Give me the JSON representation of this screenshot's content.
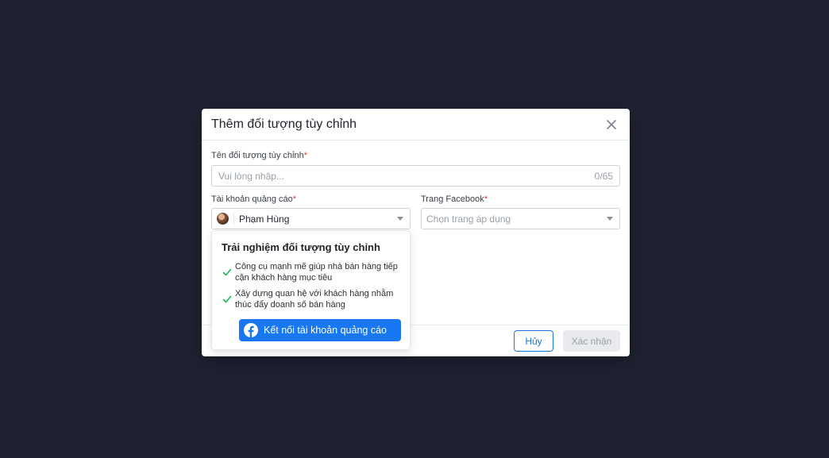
{
  "dialog": {
    "title": "Thêm đối tượng tùy chỉnh",
    "name_field": {
      "label": "Tên đối tượng tùy chỉnh",
      "required_mark": "*",
      "placeholder": "Vui lòng nhập...",
      "counter": "0/65"
    },
    "ad_account_field": {
      "label": "Tài khoản quảng cáo",
      "required_mark": "*",
      "selected": "Phạm Hùng"
    },
    "facebook_page_field": {
      "label": "Trang Facebook",
      "required_mark": "*",
      "placeholder": "Chọn trang áp dụng"
    },
    "footer": {
      "cancel_label": "Hủy",
      "confirm_label": "Xác nhận"
    }
  },
  "popover": {
    "title": "Trải nghiệm đối tượng tùy chỉnh",
    "benefits": [
      {
        "line1": "Công cụ mạnh mẽ giúp nhà bán hàng tiếp",
        "line2": "cận khách hàng mục tiêu"
      },
      {
        "line1": "Xây dựng quan hệ với khách hàng nhằm",
        "line2": "thúc đẩy doanh số bán hàng"
      }
    ],
    "connect_button": "Kết nối tài khoản quảng cáo"
  },
  "colors": {
    "backdrop": "#1f2232",
    "primary": "#1a73e8",
    "facebook": "#1877f2",
    "check": "#1db954",
    "required": "#e5383b"
  },
  "icons": [
    "close-icon",
    "chevron-down-icon",
    "check-icon",
    "facebook-icon",
    "avatar"
  ]
}
